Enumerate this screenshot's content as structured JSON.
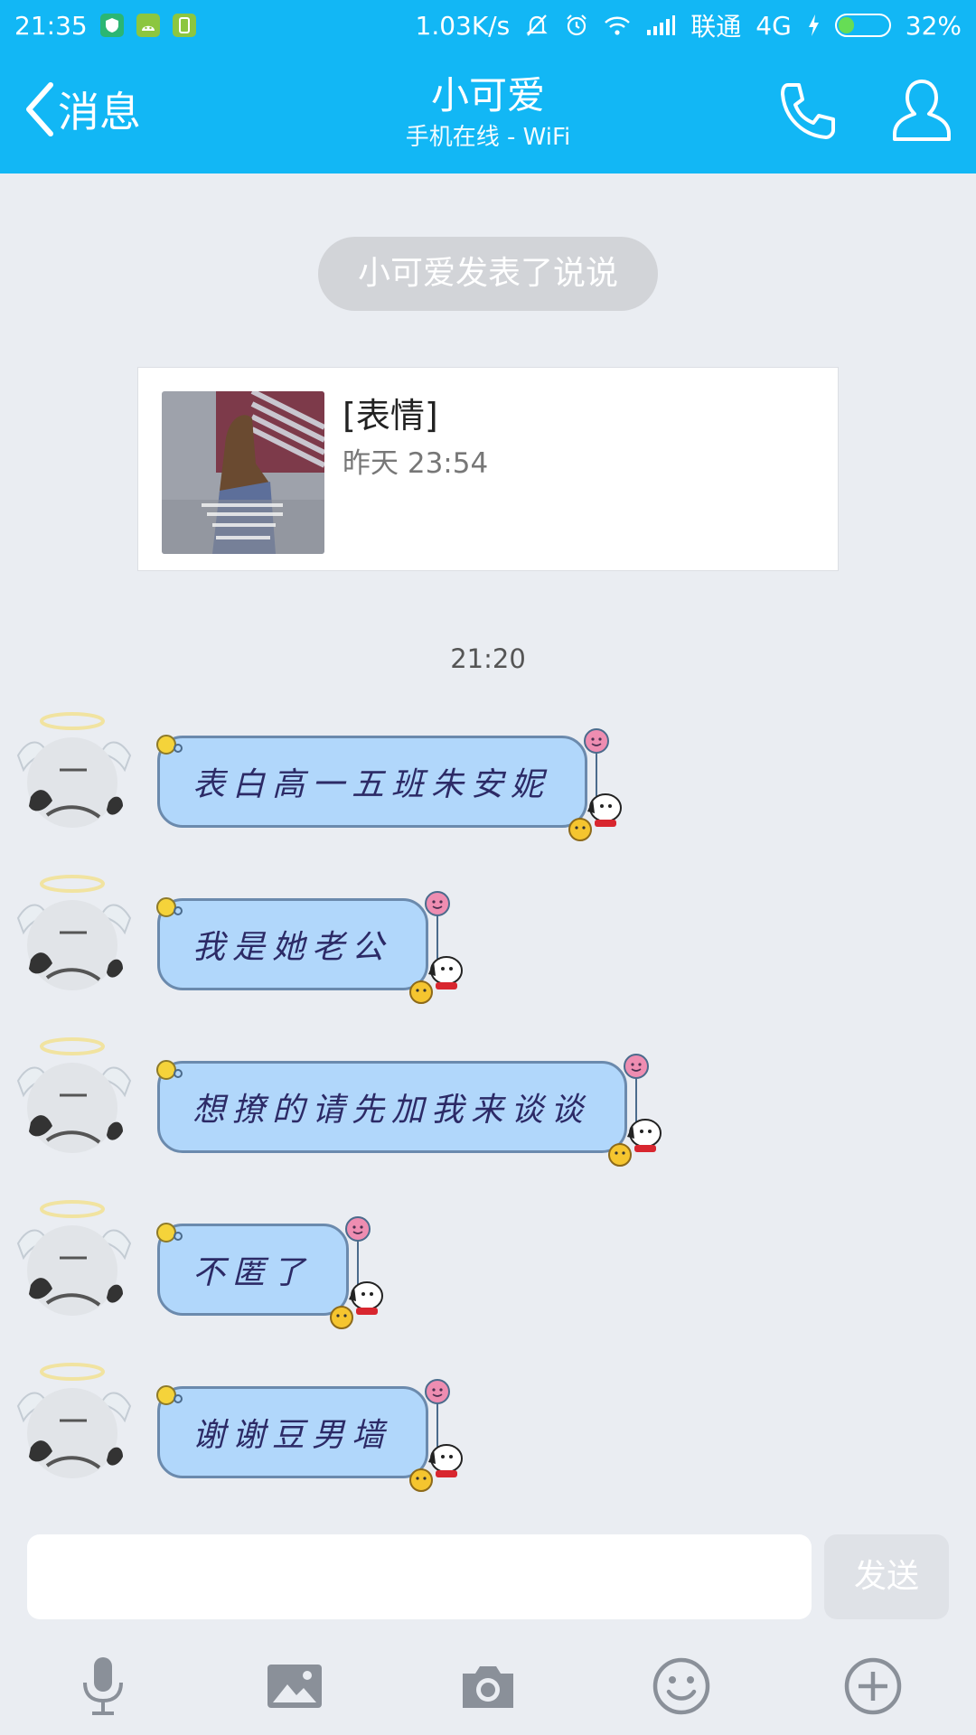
{
  "status_bar": {
    "time": "21:35",
    "network_speed": "1.03K/s",
    "carrier": "联通",
    "network_type": "4G",
    "battery_percent": "32%",
    "battery_level": 0.32,
    "icons": [
      "shield-app-icon",
      "android-app-icon",
      "phone-app-icon",
      "mute-bell-icon",
      "alarm-clock-icon",
      "wifi-icon",
      "signal-icon",
      "charging-icon",
      "battery-icon"
    ]
  },
  "header": {
    "back_label": "消息",
    "title": "小可爱",
    "subtitle": "手机在线 - WiFi",
    "call_icon": "phone-call-icon",
    "profile_icon": "profile-person-icon"
  },
  "chat": {
    "notice": "小可爱发表了说说",
    "post": {
      "title": "[表情]",
      "time": "昨天 23:54"
    },
    "time_divider": "21:20",
    "messages": [
      {
        "text": "表白高一五班朱安妮"
      },
      {
        "text": "我是她老公"
      },
      {
        "text": "想撩的请先加我来谈谈"
      },
      {
        "text": "不匿了"
      },
      {
        "text": "谢谢豆男墙"
      }
    ]
  },
  "input_bar": {
    "placeholder": "",
    "value": "",
    "send_label": "发送",
    "tools": [
      "microphone-icon",
      "image-icon",
      "camera-icon",
      "emoji-icon",
      "plus-icon"
    ]
  },
  "colors": {
    "brand_blue": "#12b7f5",
    "background": "#eaedf2",
    "bubble_fill": "#b1d7fb",
    "bubble_text": "#2c2a66"
  }
}
